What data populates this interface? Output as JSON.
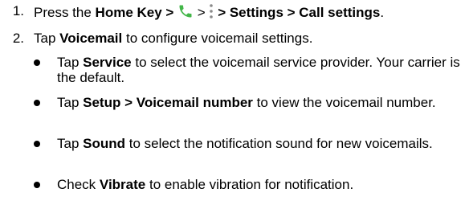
{
  "steps": [
    {
      "number": "1.",
      "parts": {
        "t1": "Press the ",
        "b1": "Home Key >",
        "t2": " ",
        "t3": " > ",
        "t4": " ",
        "b2": "> Settings > Call settings",
        "t5": "."
      },
      "icons": [
        "phone-icon",
        "overflow-menu-icon"
      ]
    },
    {
      "number": "2.",
      "parts": {
        "t1": "Tap ",
        "b1": "Voicemail",
        "t2": " to configure voicemail settings."
      }
    }
  ],
  "bullets": [
    {
      "t1": "Tap ",
      "b1": "Service",
      "t2": " to select the voicemail service provider. Your carrier is the default."
    },
    {
      "t1": "Tap ",
      "b1": "Setup > Voicemail number",
      "t2": " to view the voicemail number."
    },
    {
      "t1": "Tap ",
      "b1": "Sound",
      "t2": " to select the notification sound for new voicemails."
    },
    {
      "t1": "Check ",
      "b1": "Vibrate",
      "t2": " to enable vibration for notification."
    }
  ],
  "colors": {
    "phone_icon": "#43b649",
    "menu_icon": "#8a8a8a",
    "text": "#000000"
  }
}
